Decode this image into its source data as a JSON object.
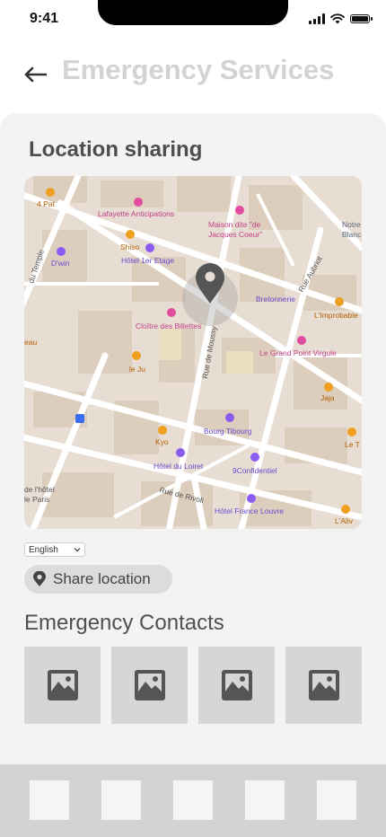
{
  "status_bar": {
    "time": "9:41"
  },
  "header": {
    "title": "Emergency Services",
    "back_icon": "arrow-left-icon"
  },
  "location": {
    "section_title": "Location sharing",
    "map_labels": [
      "4 Pat",
      "Lafayette Anticipations",
      "Maison dite \"de",
      "Jacques Coeur\"",
      "Notre",
      "Blanc",
      "Shiso",
      "Hôtel 1er Etage",
      "D'win",
      "du Temple",
      "Rue Aubriot",
      "Bretonnerie",
      "L'Improbable",
      "Cloître des Billettes",
      "le Ju",
      "Rue de Moussy",
      "Le Grand Point Virgule",
      "Jaja",
      "Bourg Tibourg",
      "Kyo",
      "Hôtel du Loiret",
      "9Confidentiel",
      "Le T",
      "Rue de Rivoli",
      "de l'hôtel",
      "le Paris",
      "Hôtel France Louvre",
      "L'Aliv",
      "eau"
    ],
    "language_select": {
      "selected": "English"
    },
    "share_button": {
      "label": "Share location",
      "icon": "location-pin-icon"
    }
  },
  "contacts": {
    "title": "Emergency Contacts",
    "items": [
      {
        "icon": "image-placeholder-icon"
      },
      {
        "icon": "image-placeholder-icon"
      },
      {
        "icon": "image-placeholder-icon"
      },
      {
        "icon": "image-placeholder-icon"
      }
    ]
  },
  "bottom_nav": {
    "item_count": 5
  },
  "colors": {
    "title_gray": "#d3d3d3",
    "card_bg": "#f3f3f3",
    "map_pin": "#555555",
    "map_poi_pink": "#e04da0",
    "map_poi_purple": "#8a5cf0",
    "map_poi_orange": "#f0a020",
    "placeholder_bg": "#d6d6d6",
    "nav_bg": "#d3d3d3"
  }
}
